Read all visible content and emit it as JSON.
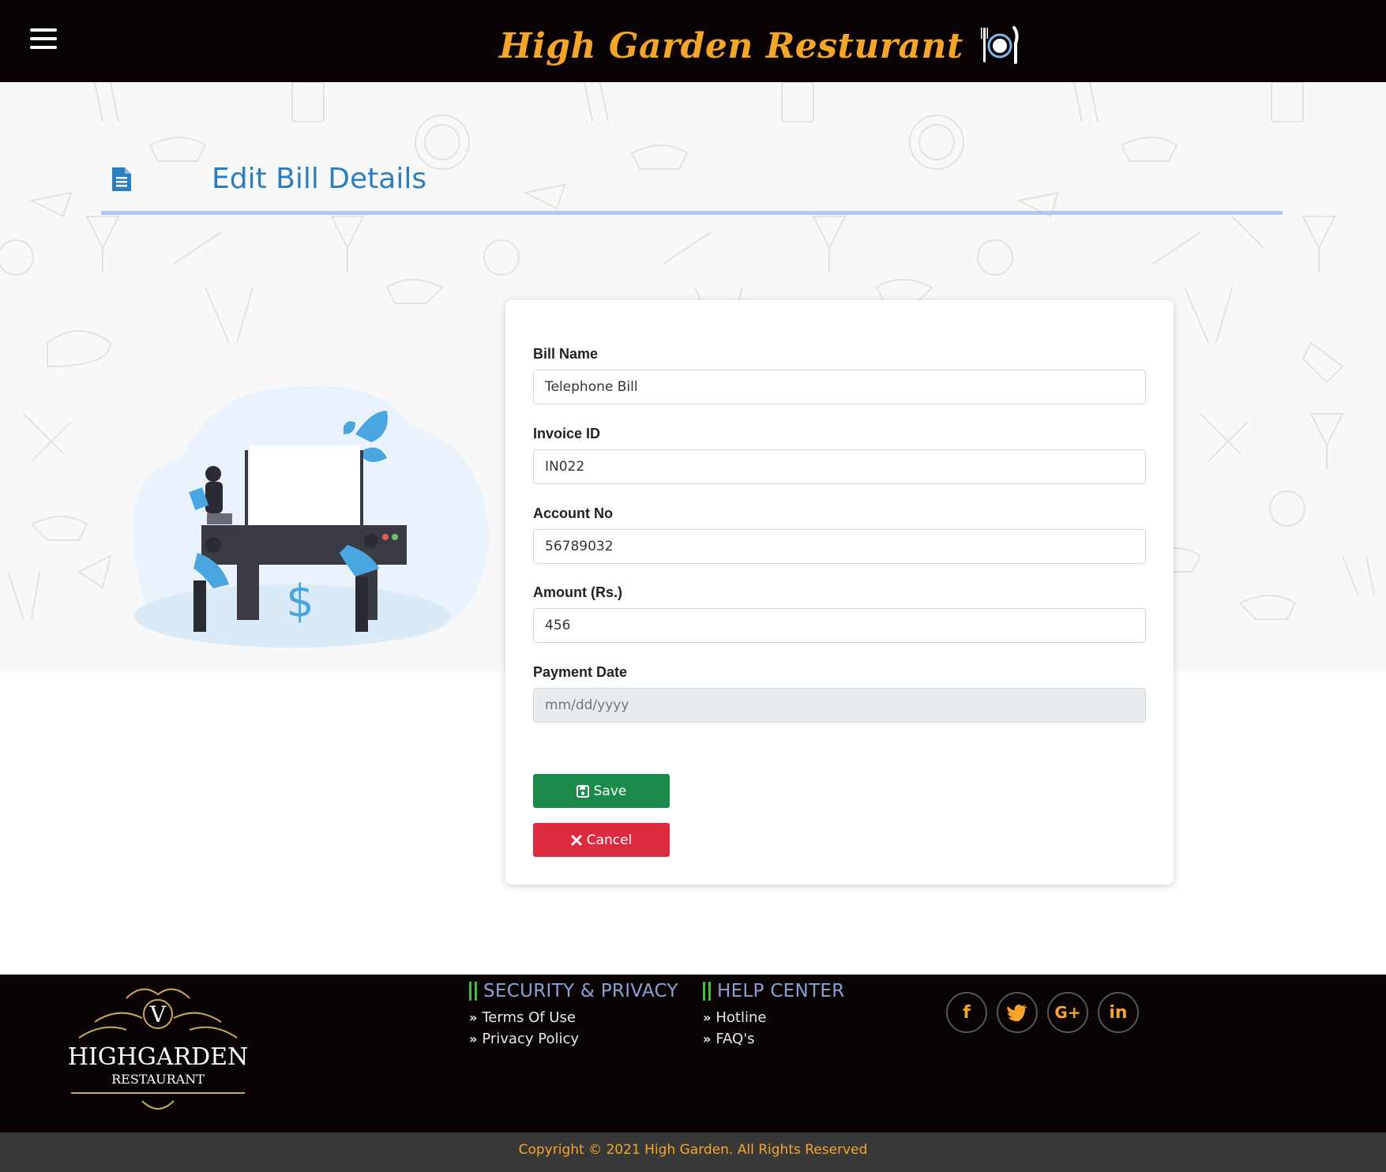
{
  "header": {
    "brand": "High Garden Resturant"
  },
  "page": {
    "title": "Edit Bill Details"
  },
  "form": {
    "bill_name_label": "Bill Name",
    "bill_name_value": "Telephone Bill",
    "invoice_label": "Invoice ID",
    "invoice_value": "IN022",
    "account_label": "Account No",
    "account_value": "56789032",
    "amount_label": "Amount (Rs.)",
    "amount_value": "456",
    "date_label": "Payment Date",
    "date_placeholder": "mm/dd/yyyy",
    "save_label": "Save",
    "cancel_label": "Cancel"
  },
  "footer": {
    "logo_letter": "V",
    "logo_name": "HIGHGARDEN",
    "logo_sub": "RESTAURANT",
    "security_title": "SECURITY & PRIVACY",
    "security_links": [
      "Terms Of Use",
      "Privacy Policy"
    ],
    "help_title": "HELP CENTER",
    "help_links": [
      "Hotline",
      "FAQ's"
    ],
    "socials": [
      "f",
      "t",
      "G+",
      "in"
    ],
    "copyright": "Copyright © 2021 High Garden. All Rights Reserved"
  },
  "colors": {
    "brand": "#f5a62a",
    "title_blue": "#2c7fbf",
    "save_green": "#1b8a4a",
    "cancel_red": "#dc2b3f"
  }
}
